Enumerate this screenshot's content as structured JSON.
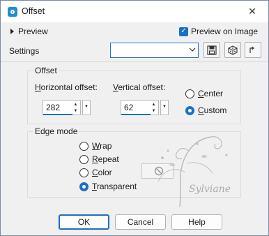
{
  "window": {
    "title": "Offset",
    "close_label": "✕"
  },
  "preview": {
    "toggle_label": "Preview",
    "checkbox_label": "Preview on Image",
    "checked": true
  },
  "settings": {
    "label": "Settings",
    "value": ""
  },
  "offset": {
    "group_title": "Offset",
    "horizontal_label_u": "H",
    "horizontal_label_rest": "orizontal offset:",
    "horizontal_value": "282",
    "vertical_label_u": "V",
    "vertical_label_rest": "ertical offset:",
    "vertical_value": "62",
    "center_label_u": "C",
    "center_label_rest": "enter",
    "custom_label_u": "C",
    "custom_label_rest": "ustom",
    "selected": "custom"
  },
  "edge_mode": {
    "group_title": "Edge mode",
    "options": [
      {
        "u": "W",
        "rest": "rap"
      },
      {
        "u": "R",
        "rest": "epeat"
      },
      {
        "u": "C",
        "rest": "olor"
      },
      {
        "u": "T",
        "rest": "ransparent"
      }
    ],
    "selected": "Transparent"
  },
  "buttons": {
    "ok": "OK",
    "cancel": "Cancel",
    "help": "Help"
  },
  "watermark_text": "Sylviane",
  "colors": {
    "accent": "#1c6fc7"
  }
}
